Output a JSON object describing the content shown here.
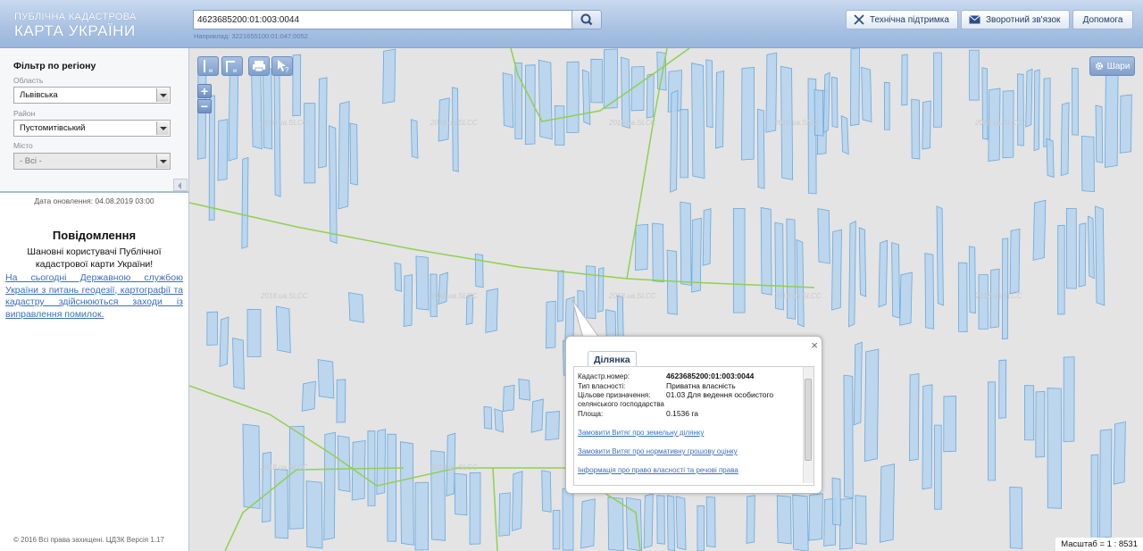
{
  "header": {
    "logo_line1": "ПУБЛІЧНА КАДАСТРОВА",
    "logo_line2": "КАРТА УКРАЇНИ",
    "search_value": "4623685200:01:003:0044",
    "search_hint": "Наприклад: 3221655100:01:047:0052",
    "support_label": "Технічна підтримка",
    "feedback_label": "Зворотний зв'язок",
    "help_label": "Допомога"
  },
  "sidebar": {
    "filter_title": "Фільтр по регіону",
    "region_label": "Область",
    "region_value": "Львівська",
    "district_label": "Район",
    "district_value": "Пустомитівський",
    "city_label": "Місто",
    "city_value": "- Всі -",
    "update_date": "Дата оновлення: 04.08.2019 03:00",
    "notice_title": "Повідомлення",
    "notice_text": "Шановні користувачі Публічної кадастрової карти України!",
    "notice_link": "На сьогодні Державною службою України з питань геодезії, картографії та кадастру здійснюються заходи із виправлення помилок.",
    "copyright": "© 2016 Всі права захищені. ЦДЗК Версія 1.17"
  },
  "map": {
    "layers_label": "Шари",
    "zoom_in": "+",
    "zoom_out": "−",
    "scale_text": "Масштаб = 1 : 8531",
    "watermark": "2018 ua.SLCC",
    "colors": {
      "background": "#e4e4e4",
      "parcel_fill": "#b5d3ee",
      "parcel_stroke": "#6aa8dc",
      "boundary": "#8fd14f"
    }
  },
  "popup": {
    "tab_label": "Ділянка",
    "rows": [
      {
        "label": "Кадастр.номер:",
        "value": "4623685200:01:003:0044"
      },
      {
        "label": "Тип власності:",
        "value": "Приватна власність"
      },
      {
        "label": "Цільове призначення:",
        "value": "01.03 Для ведення особистого"
      },
      {
        "label": "селянського господарства",
        "value": ""
      },
      {
        "label": "Площа:",
        "value": "0.1536 га"
      }
    ],
    "links": [
      "Замовити Витяг про земельну ділянку",
      "Замовити Витяг про нормативну грошову оцінку",
      "Інформація про право власності та речові права"
    ],
    "close": "×"
  }
}
